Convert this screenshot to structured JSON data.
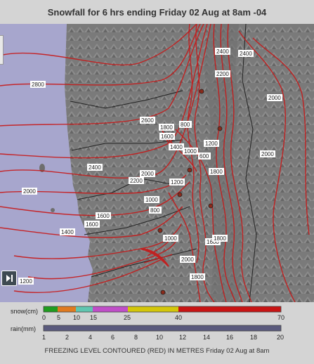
{
  "title": "Snowfall for 6 hrs ending Friday 02 Aug at 8am -04",
  "contour_labels": [
    {
      "text": "2800"
    },
    {
      "text": "2600"
    },
    {
      "text": "2400"
    },
    {
      "text": "2000"
    },
    {
      "text": "1600"
    },
    {
      "text": "1400"
    },
    {
      "text": "1200"
    },
    {
      "text": "2400"
    },
    {
      "text": "2000"
    },
    {
      "text": "2200"
    },
    {
      "text": "1800"
    },
    {
      "text": "1600"
    },
    {
      "text": "1400"
    },
    {
      "text": "1000"
    },
    {
      "text": "600"
    },
    {
      "text": "800"
    },
    {
      "text": "2200"
    },
    {
      "text": "1200"
    },
    {
      "text": "2000"
    },
    {
      "text": "2400"
    },
    {
      "text": "1800"
    },
    {
      "text": "1600"
    },
    {
      "text": "2000"
    },
    {
      "text": "1000"
    },
    {
      "text": "1200"
    },
    {
      "text": "1800"
    },
    {
      "text": "1000"
    },
    {
      "text": "800"
    },
    {
      "text": "1600"
    },
    {
      "text": "1800"
    },
    {
      "text": "2000"
    }
  ],
  "legend": {
    "snow_label": "snow(cm)",
    "rain_label": "rain(mm)",
    "snow_ticks": [
      "0",
      "5",
      "10",
      "15",
      "25",
      "40",
      "70"
    ],
    "rain_ticks": [
      "1",
      "2",
      "4",
      "6",
      "8",
      "10",
      "12",
      "14",
      "16",
      "18",
      "20"
    ],
    "snow_colors": [
      "#1f9d1f",
      "#e07a1f",
      "#5fc6b0",
      "#c04ec8",
      "#d4c70a",
      "#c81414"
    ]
  },
  "footer": "FREEZING LEVEL CONTOURED (RED) IN METRES Friday 02 Aug at 8am"
}
